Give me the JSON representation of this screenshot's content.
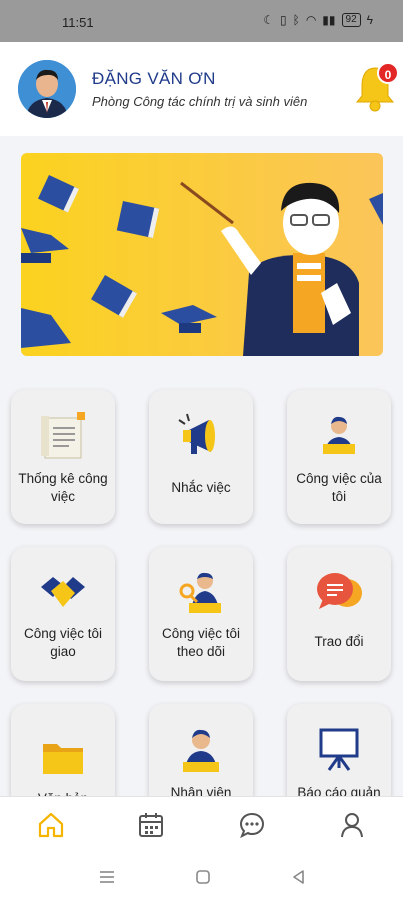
{
  "status_bar": {
    "time": "11:51",
    "battery": "92"
  },
  "header": {
    "user_name": "ĐẶNG VĂN ƠN",
    "department": "Phòng Công tác chính trị và sinh viên",
    "notification_count": "0"
  },
  "tiles": [
    {
      "label": "Thống kê công việc",
      "icon": "report-icon"
    },
    {
      "label": "Nhắc việc",
      "icon": "megaphone-icon"
    },
    {
      "label": "Công việc của tôi",
      "icon": "person-icon"
    },
    {
      "label": "Công việc tôi giao",
      "icon": "handshake-icon"
    },
    {
      "label": "Công việc tôi theo dõi",
      "icon": "search-person-icon"
    },
    {
      "label": "Trao đổi",
      "icon": "chat-icon"
    },
    {
      "label": "Văn bản",
      "icon": "folder-icon"
    },
    {
      "label": "Nhân viên",
      "icon": "employee-icon"
    },
    {
      "label": "Báo cáo quản",
      "icon": "presentation-icon"
    }
  ],
  "bottom_nav": [
    {
      "name": "home",
      "icon": "home-icon",
      "active": true
    },
    {
      "name": "calendar",
      "icon": "calendar-icon",
      "active": false
    },
    {
      "name": "messages",
      "icon": "message-icon",
      "active": false
    },
    {
      "name": "profile",
      "icon": "user-icon",
      "active": false
    }
  ],
  "colors": {
    "accent": "#f5c518",
    "brand_blue": "#1f3b8a",
    "badge": "#e32626"
  }
}
